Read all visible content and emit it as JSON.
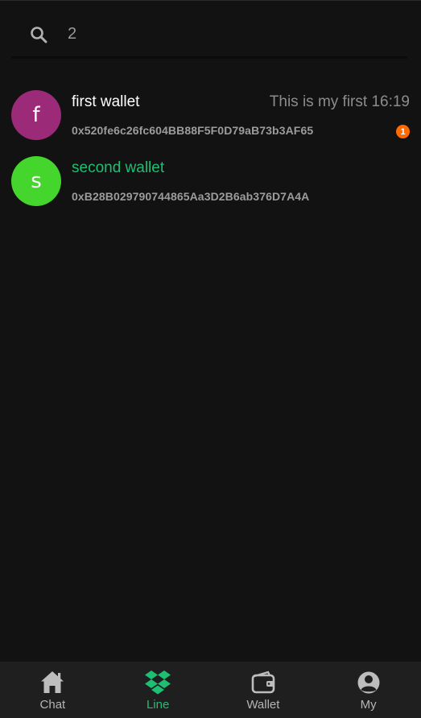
{
  "search": {
    "value": "2",
    "icon": "search-icon"
  },
  "wallets": [
    {
      "avatar_letter": "f",
      "avatar_color": "#9b2a78",
      "name": "first wallet",
      "name_color": "#ffffff",
      "preview": "This is my first 16:19",
      "address": "0x520fe6c26fc604BB88F5F0D79aB73b3AF65",
      "badge": "1"
    },
    {
      "avatar_letter": "s",
      "avatar_color": "#44d62c",
      "name": "second wallet",
      "name_color": "#1dbf73",
      "preview": "",
      "address": "0xB28B029790744865Aa3D2B6ab376D7A4A",
      "badge": ""
    }
  ],
  "nav": {
    "active_color": "#1dbf73",
    "items": [
      {
        "label": "Chat",
        "icon": "home-icon",
        "active": false
      },
      {
        "label": "Line",
        "icon": "dropbox-icon",
        "active": true
      },
      {
        "label": "Wallet",
        "icon": "wallet-icon",
        "active": false
      },
      {
        "label": "My",
        "icon": "account-icon",
        "active": false
      }
    ]
  }
}
